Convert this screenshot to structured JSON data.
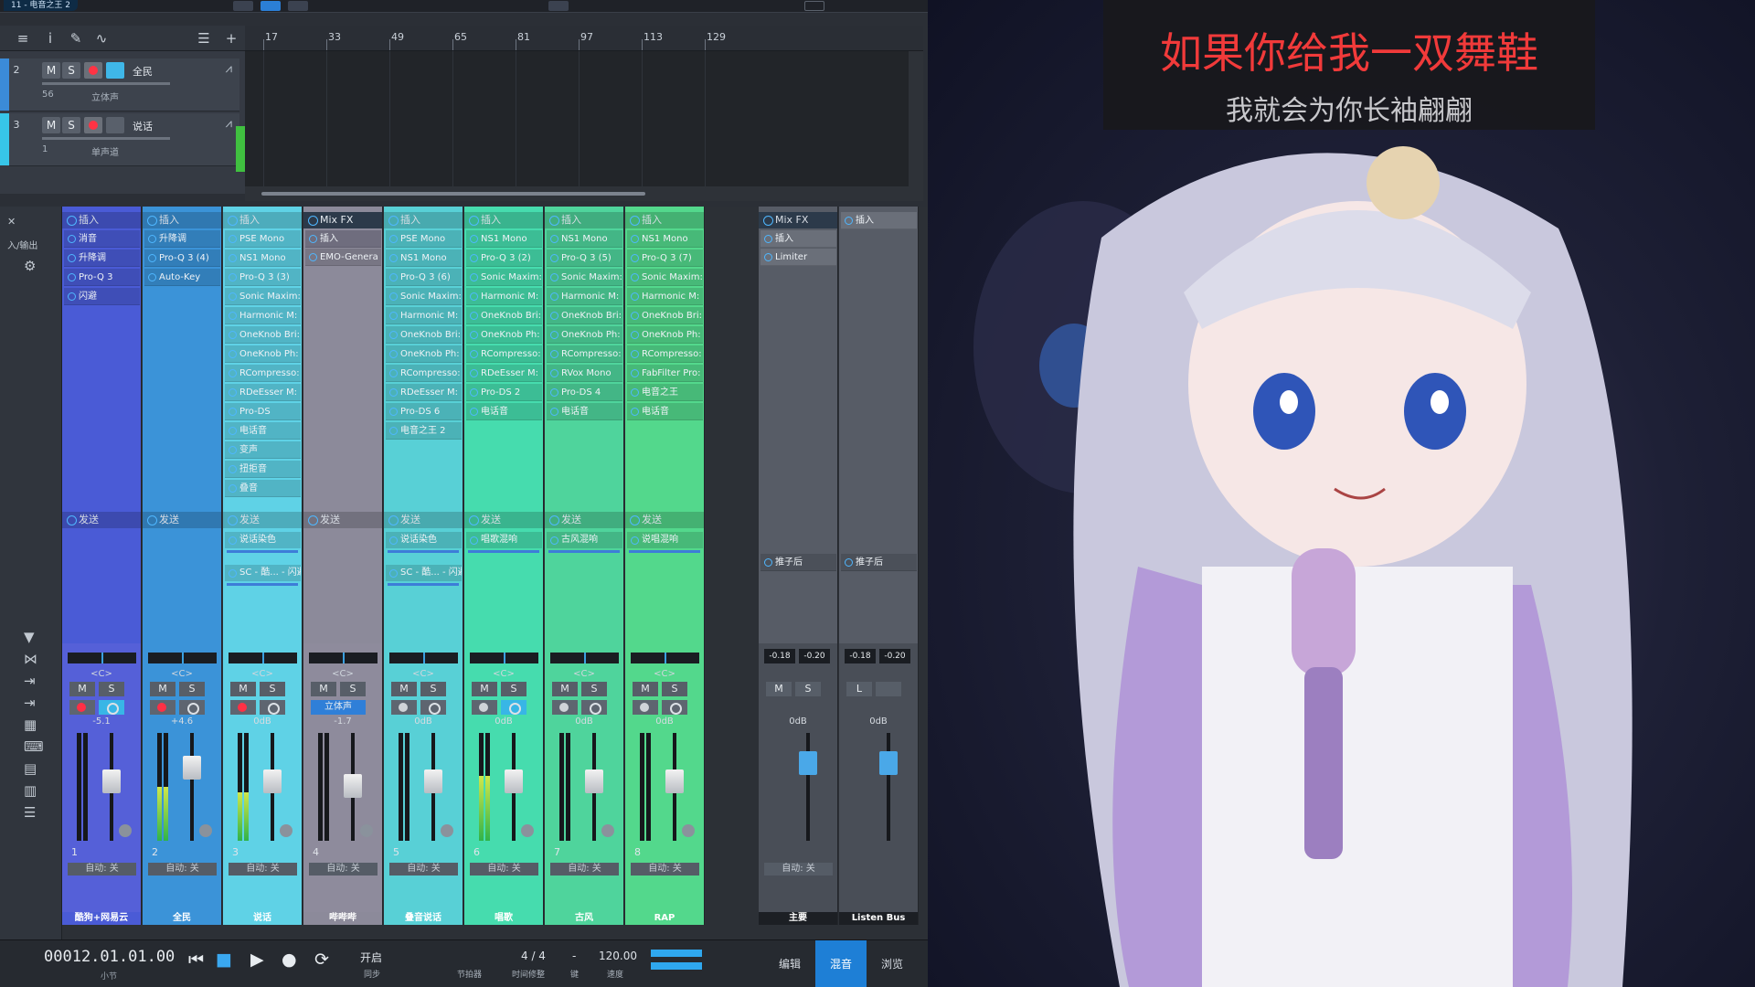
{
  "titlebar": {
    "title": "11 - 电音之王 2"
  },
  "arrange": {
    "ruler_ticks": [
      "17",
      "33",
      "49",
      "65",
      "81",
      "97",
      "113",
      "129"
    ],
    "tracks": [
      {
        "num": "2",
        "name": "全民",
        "volume": "56",
        "mode": "立体声",
        "color": "#3b8bd8"
      },
      {
        "num": "3",
        "name": "说话",
        "volume": "1",
        "mode": "单声道",
        "color": "#37c6e8"
      }
    ]
  },
  "mixer": {
    "left_labels": [
      "入/输出"
    ],
    "channels": [
      {
        "num": "1",
        "name": "酷狗+网易云",
        "color": "#4a5bd6",
        "lower": "#5560d8",
        "ins": "插入",
        "plugins": [
          "消音",
          "升降调",
          "Pro-Q 3",
          "闪避"
        ],
        "send": "发送",
        "sends": [],
        "pan": "<C>",
        "db": "-5.1",
        "rec": true,
        "mon": true,
        "auto": "自动: 关",
        "fader": 0.6,
        "meter": 0.0
      },
      {
        "num": "2",
        "name": "全民",
        "color": "#3b93d8",
        "lower": "#3b93d8",
        "ins": "插入",
        "plugins": [
          "升降调",
          "Pro-Q 3 (4)",
          "Auto-Key"
        ],
        "send": "发送",
        "sends": [],
        "pan": "<C>",
        "db": "+4.6",
        "rec": true,
        "mon": false,
        "auto": "自动: 关",
        "fader": 0.75,
        "meter": 0.5
      },
      {
        "num": "3",
        "name": "说话",
        "color": "#5fd2e6",
        "lower": "#5fd2e6",
        "ins": "插入",
        "plugins": [
          "PSE Mono",
          "NS1 Mono",
          "Pro-Q 3 (3)",
          "Sonic Maxim:",
          "Harmonic M:",
          "OneKnob Bri:",
          "OneKnob Ph:",
          "RCompresso:",
          "RDeEsser M:",
          "Pro-DS",
          "电话音",
          "变声",
          "扭拒音",
          "叠音"
        ],
        "send": "发送",
        "sends": [
          "说话染色",
          "SC - 酷... - 闪避"
        ],
        "pan": "<C>",
        "db": "0dB",
        "rec": true,
        "mon": false,
        "auto": "自动: 关",
        "fader": 0.6,
        "meter": 0.45
      },
      {
        "num": "4",
        "name": "哔哔哔",
        "color": "#8c8a9a",
        "lower": "#8e8b9c",
        "ins": "插入",
        "plugins": [
          "EMO-Genera"
        ],
        "send": "发送",
        "sends": [],
        "pan": "<C>",
        "db": "-1.7",
        "rec": false,
        "mon": false,
        "mode": "立体声",
        "auto": "自动: 关",
        "fader": 0.55,
        "meter": 0.0,
        "hdr": "Mix FX"
      },
      {
        "num": "5",
        "name": "叠音说话",
        "color": "#58d0d6",
        "lower": "#58d0d6",
        "ins": "插入",
        "plugins": [
          "PSE Mono",
          "NS1 Mono",
          "Pro-Q 3 (6)",
          "Sonic Maxim:",
          "Harmonic M:",
          "OneKnob Bri:",
          "OneKnob Ph:",
          "RCompresso:",
          "RDeEsser M:",
          "Pro-DS 6",
          "电音之王 2"
        ],
        "send": "发送",
        "sends": [
          "说话染色",
          "SC - 酷... - 闪避"
        ],
        "pan": "<C>",
        "db": "0dB",
        "rec": false,
        "mon": false,
        "auto": "自动: 关",
        "fader": 0.6,
        "meter": 0.0
      },
      {
        "num": "6",
        "name": "唱歌",
        "color": "#46dcae",
        "lower": "#46dcae",
        "ins": "插入",
        "plugins": [
          "NS1 Mono",
          "Pro-Q 3 (2)",
          "Sonic Maxim:",
          "Harmonic M:",
          "OneKnob Bri:",
          "OneKnob Ph:",
          "RCompresso:",
          "RDeEsser M:",
          "Pro-DS 2",
          "电话音"
        ],
        "send": "发送",
        "sends": [
          "唱歌混响"
        ],
        "pan": "<C>",
        "db": "0dB",
        "rec": false,
        "mon": true,
        "auto": "自动: 关",
        "fader": 0.6,
        "meter": 0.6
      },
      {
        "num": "7",
        "name": "古风",
        "color": "#4fd49c",
        "lower": "#4fd49c",
        "ins": "插入",
        "plugins": [
          "NS1 Mono",
          "Pro-Q 3 (5)",
          "Sonic Maxim:",
          "Harmonic M:",
          "OneKnob Bri:",
          "OneKnob Ph:",
          "RCompresso:",
          "RVox Mono",
          "Pro-DS 4",
          "电话音"
        ],
        "send": "发送",
        "sends": [
          "古风混响"
        ],
        "pan": "<C>",
        "db": "0dB",
        "rec": false,
        "mon": false,
        "auto": "自动: 关",
        "fader": 0.6,
        "meter": 0.0
      },
      {
        "num": "8",
        "name": "RAP",
        "color": "#53d88c",
        "lower": "#53d88c",
        "ins": "插入",
        "plugins": [
          "NS1 Mono",
          "Pro-Q 3 (7)",
          "Sonic Maxim:",
          "Harmonic M:",
          "OneKnob Bri:",
          "OneKnob Ph:",
          "RCompresso:",
          "FabFilter Pro:",
          "电音之王",
          "电话音"
        ],
        "send": "发送",
        "sends": [
          "说唱混响"
        ],
        "pan": "<C>",
        "db": "0dB",
        "rec": false,
        "mon": false,
        "auto": "自动: 关",
        "fader": 0.6,
        "meter": 0.0
      }
    ],
    "buses": [
      {
        "name": "主要",
        "hdr": "Mix FX",
        "ins": "插入",
        "plugins": [
          "Limiter"
        ],
        "post": "推子后",
        "db": "0dB",
        "peakL": "-0.18",
        "peakR": "-0.20",
        "auto": "自动: 关",
        "b1": "M",
        "b2": "S"
      },
      {
        "name": "Listen Bus",
        "hdr": "",
        "ins": "插入",
        "plugins": [],
        "post": "推子后",
        "db": "0dB",
        "peakL": "-0.18",
        "peakR": "-0.20",
        "auto": "",
        "b1": "L",
        "b2": ""
      }
    ]
  },
  "transport": {
    "timecode": "00012.01.01.00",
    "timecode_unit": "小节",
    "sync_top": "开启",
    "sync_bottom": "同步",
    "metronome": "节拍器",
    "signature": "4 / 4",
    "signature_label": "时间修整",
    "key_label": "键",
    "key_value": "-",
    "tempo": "120.00",
    "tempo_label": "速度",
    "tabs": [
      "编辑",
      "混音",
      "浏览"
    ],
    "active_tab": "混音"
  },
  "stream": {
    "lyric_line1": "如果你给我一双舞鞋",
    "lyric_line2": "我就会为你长袖翩翩"
  }
}
